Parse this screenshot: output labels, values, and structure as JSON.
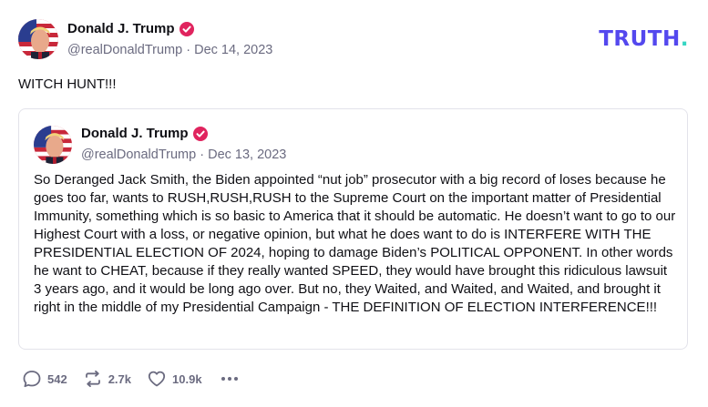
{
  "post": {
    "author_name": "Donald J. Trump",
    "handle": "@realDonaldTrump",
    "separator": "·",
    "date": "Dec 14, 2023",
    "text": "WITCH HUNT!!!",
    "avatar_icon": "profile-avatar",
    "verified_icon": "verified-badge-icon",
    "verified_color": "#e0245e"
  },
  "brand": {
    "logo_text": "TRUTH",
    "logo_dot": ".",
    "logo_color": "#5448ee",
    "logo_dot_color": "#36d6c3"
  },
  "quoted_post": {
    "author_name": "Donald J. Trump",
    "handle": "@realDonaldTrump",
    "separator": "·",
    "date": "Dec 13, 2023",
    "text": "So Deranged Jack Smith, the Biden appointed “nut job” prosecutor with a big record of loses because he goes too far, wants to RUSH,RUSH,RUSH to the Supreme Court on the important matter of  Presidential Immunity, something which is so basic to America that it should be automatic. He doesn’t want to go to our Highest Court with a loss, or negative opinion, but what he does want to do is INTERFERE WITH THE PRESIDENTIAL ELECTION OF 2024, hoping to damage Biden’s POLITICAL OPPONENT. In other words he want to CHEAT, because if they really wanted SPEED, they would have brought this ridiculous lawsuit 3 years ago, and it would be long ago over. But no, they Waited, and Waited, and Waited, and brought it right in the middle of my Presidential Campaign - THE DEFINITION OF ELECTION INTERFERENCE!!!"
  },
  "actions": {
    "replies": "542",
    "retruths": "2.7k",
    "likes": "10.9k",
    "reply_icon": "reply-icon",
    "retruth_icon": "retruth-icon",
    "like_icon": "heart-icon",
    "more_icon": "more-icon"
  }
}
